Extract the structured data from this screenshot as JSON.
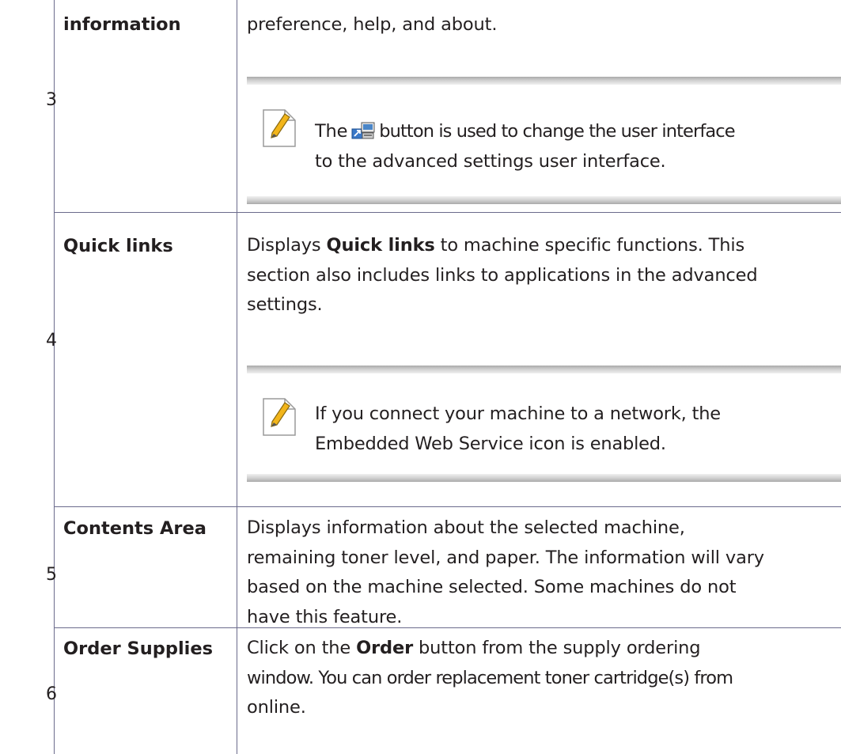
{
  "rows": [
    {
      "number": "3",
      "feature": "information",
      "description": "preference, help, and about.",
      "note": {
        "pre": "The",
        "icon": "advanced-ui-switch-icon",
        "line1_post": "button is used to change the user interface",
        "line2": "to the advanced settings user interface."
      }
    },
    {
      "number": "4",
      "feature": "Quick links",
      "description": {
        "pre": "Displays",
        "bold": "Quick links",
        "line1_post": "to machine specific functions. This",
        "line2": "section also includes links to applications in the advanced",
        "line3": "settings."
      },
      "note": {
        "line1": "If you connect your machine to a network, the",
        "line2": "Embedded Web Service icon is enabled."
      }
    },
    {
      "number": "5",
      "feature": "Contents Area",
      "description": {
        "line1": "Displays information about the selected machine,",
        "line2": "remaining toner level, and paper. The information will vary",
        "line3": "based on the machine selected. Some machines do not",
        "line4": "have this feature."
      }
    },
    {
      "number": "6",
      "feature": "Order Supplies",
      "description": {
        "pre": "Click on the",
        "bold": "Order",
        "line1_post": "button from the supply ordering",
        "line2": "window. You can order replacement toner cartridge(s) from",
        "line3": "online."
      }
    }
  ],
  "note_icon": "note-pencil-icon",
  "colors": {
    "rule": "#6b6b8c",
    "note_icon_accent": "#f2b51a",
    "text": "#231f20"
  }
}
